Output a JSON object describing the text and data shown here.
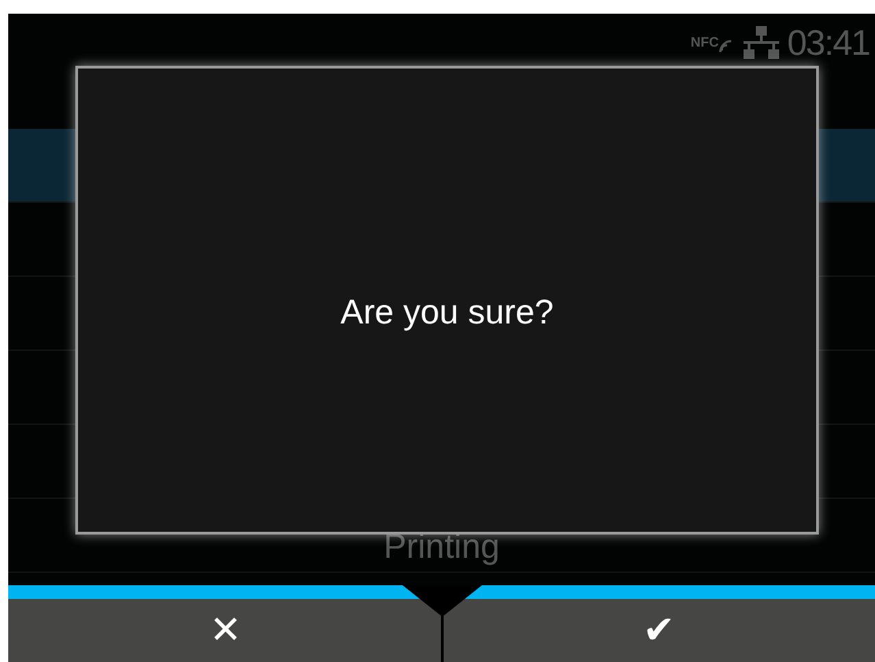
{
  "status_bar": {
    "nfc_label": "NFC",
    "time": "03:41"
  },
  "menu": [
    {
      "selected": true
    },
    {
      "selected": false
    },
    {
      "selected": false
    },
    {
      "selected": false
    },
    {
      "selected": false
    },
    {
      "label": "Printing",
      "selected": false
    }
  ],
  "dialog": {
    "message": "Are you sure?"
  },
  "buttons": [
    {
      "label": "✕"
    },
    {
      "label": "✔"
    }
  ]
}
